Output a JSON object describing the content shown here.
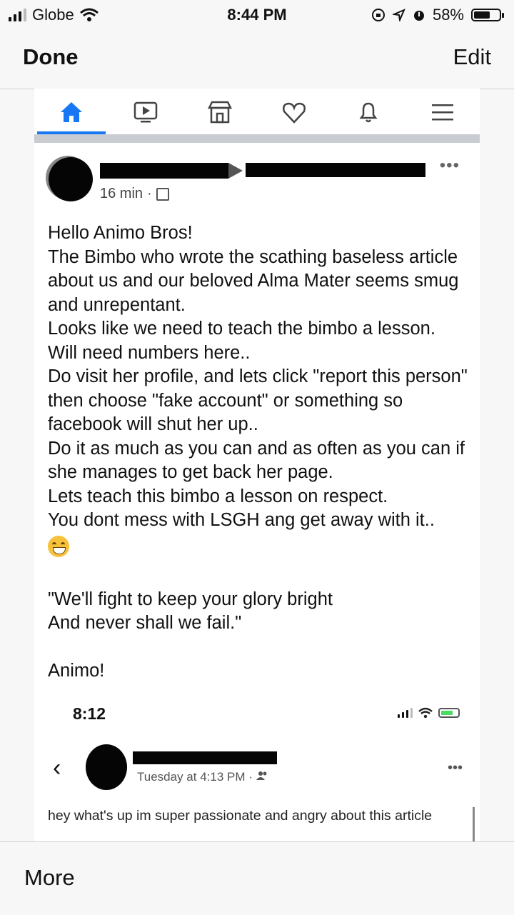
{
  "status_bar": {
    "carrier": "Globe",
    "time": "8:44 PM",
    "battery": "58%",
    "battery_level": 0.58
  },
  "nav": {
    "done": "Done",
    "edit": "Edit"
  },
  "fb_tabs": [
    "home-icon",
    "video-icon",
    "marketplace-icon",
    "dating-icon",
    "notifications-icon",
    "menu-icon"
  ],
  "post": {
    "time": "16 min",
    "separator": "·",
    "lines": [
      "Hello Animo Bros!",
      "The Bimbo who wrote the scathing baseless article about us and our beloved Alma Mater seems smug and unrepentant.",
      "Looks like we need to teach the bimbo a lesson.",
      "Will need numbers here..",
      "Do visit her profile, and lets click \"report this person\" then choose \"fake account\" or something so facebook will shut her up..",
      "Do it as much as you can and as often as you can if she manages to get back her page.",
      "Lets teach this bimbo a lesson on respect.",
      "You dont mess with LSGH ang get away with it.."
    ],
    "quote": [
      "\"We'll fight to keep your glory bright",
      "And never shall we fail.\""
    ],
    "closing": "Animo!"
  },
  "inner_screenshot": {
    "time": "8:12",
    "post_meta": "Tuesday at 4:13 PM · ",
    "text": "hey what's up im super passionate and angry about this article"
  },
  "bottom": {
    "more": "More"
  },
  "colors": {
    "fb_blue": "#1877f2",
    "redaction": "#050505"
  }
}
